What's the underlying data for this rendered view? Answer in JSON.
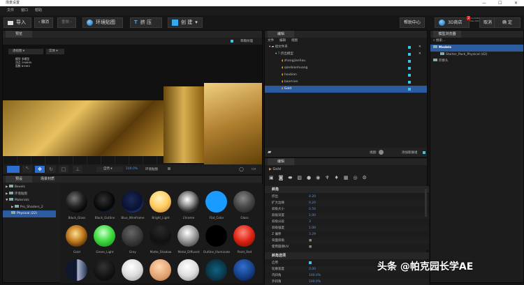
{
  "window": {
    "title": "场景设置",
    "minimize": "—",
    "maximize": "☐",
    "close": "✕"
  },
  "menu": [
    "文件",
    "窗口",
    "帮助"
  ],
  "toolbar": {
    "import": "导入",
    "undo": "‹ 撤消",
    "redo": "重做 ›",
    "env_map": "环境贴图",
    "extrude": "挤 压",
    "create": "创 建",
    "help": "帮助中心",
    "store": "3D商店",
    "store_badge": "2",
    "cancel": "取消",
    "ok": "确 定",
    "gpu_info": "Quadro M2000/PCIe/SSE2",
    "gpu_info2": "1024/4096 MB Video RAM",
    "product": "Element",
    "version": "2.2.2"
  },
  "viewport": {
    "tab": "预览",
    "draft_texture": "草稿纹理",
    "camera_select": "透视图",
    "render_mode": "实体",
    "stats": [
      {
        "k": "模型",
        "v": "多模型"
      },
      {
        "k": "顶点",
        "v": "290895"
      },
      {
        "k": "面数",
        "v": "83365"
      }
    ],
    "shading": "自然",
    "zoom": "100.0%",
    "env_label": "环境贴图"
  },
  "library": {
    "tabs": [
      "预设",
      "场景材质"
    ],
    "tree": [
      {
        "label": "Bevels",
        "level": 0,
        "arrow": "▶"
      },
      {
        "label": "环境贴图",
        "level": 0,
        "arrow": "▶"
      },
      {
        "label": "Materials",
        "level": 0,
        "arrow": "▼"
      },
      {
        "label": "Pro_Shaders_2",
        "level": 1,
        "arrow": "▶"
      },
      {
        "label": "Physical (22)",
        "level": 1,
        "arrow": "",
        "selected": true
      }
    ],
    "materials": [
      {
        "name": "Black_Gloss",
        "bg": "radial-gradient(circle at 40% 35%,#777,#222 45%,#000 80%)"
      },
      {
        "name": "Black_Outline",
        "bg": "radial-gradient(circle at 45% 40%,#333,#050505 60%,#2a4b88 95%)"
      },
      {
        "name": "Blue_Wireframe",
        "bg": "radial-gradient(circle at 45% 40%,#1c2a55,#0a1030 60%,#3a6cf0 95%)"
      },
      {
        "name": "Bright_Light",
        "bg": "radial-gradient(circle at 45% 35%,#fff3c0,#ffcc60 50%,#c08030 95%)"
      },
      {
        "name": "Chrome",
        "bg": "radial-gradient(circle at 45% 40%,#fff,#999 35%,#222 70%,#aaa 95%)"
      },
      {
        "name": "Flat_Color",
        "bg": "#1a9bff"
      },
      {
        "name": "Glass",
        "bg": "radial-gradient(circle at 45% 35%,#888,#444 50%,#222 90%)"
      },
      {
        "name": "Gold",
        "bg": "radial-gradient(circle at 45% 40%,#ffe090,#c07a20 45%,#3a2000 85%)"
      },
      {
        "name": "Green_Light",
        "bg": "radial-gradient(circle at 45% 35%,#d0ffd0,#44dd44 45%,#118811 95%)"
      },
      {
        "name": "Grey",
        "bg": "radial-gradient(circle at 45% 35%,#666,#333 60%,#1a1a1a 95%)"
      },
      {
        "name": "Matte_Shadow",
        "bg": "radial-gradient(circle at 50% 20%,#2a2a2a,#111 60%,#1c1c1c)"
      },
      {
        "name": "Metal_Diffused",
        "bg": "radial-gradient(circle at 45% 35%,#fff,#aaa 40%,#333 90%)"
      },
      {
        "name": "Outline_Illuminate",
        "bg": "radial-gradient(circle,#000 85%,#8a4a20 97%)"
      },
      {
        "name": "Paint_Red",
        "bg": "radial-gradient(circle at 45% 35%,#ff8a7a,#dd2211 50%,#661100 95%)"
      },
      {
        "name": "",
        "bg": "linear-gradient(90deg,#101830 50%,#aab4cc 55%,#223050)"
      },
      {
        "name": "",
        "bg": "radial-gradient(circle at 45% 35%,#333,#111 60%,#080808)"
      },
      {
        "name": "",
        "bg": "radial-gradient(circle at 45% 35%,#fff,#ddd 50%,#999 95%)"
      },
      {
        "name": "",
        "bg": "radial-gradient(circle at 45% 35%,#ffd7b0,#e0a070 60%,#a06030)"
      },
      {
        "name": "",
        "bg": "radial-gradient(circle at 45% 35%,#fff,#ddd 50%,#888 95%)"
      },
      {
        "name": "",
        "bg": "radial-gradient(circle,#106080,#0a3040 70%,#4fd0ff 95%)"
      },
      {
        "name": "",
        "bg": "radial-gradient(circle at 45% 35%,#3070d0,#103070 70%,#051530)"
      }
    ]
  },
  "scene": {
    "tab": "编辑",
    "menu": [
      "文件",
      "编辑",
      "视图"
    ],
    "items": [
      {
        "label": "组文件夹",
        "level": 0,
        "icon": "folder"
      },
      {
        "label": "挤出模型",
        "level": 1,
        "icon": "extrude"
      },
      {
        "label": "zhangjianhau",
        "level": 2,
        "icon": "material"
      },
      {
        "label": "qianbianhuang",
        "level": 2,
        "icon": "material"
      },
      {
        "label": "houbian",
        "level": 2,
        "icon": "material"
      },
      {
        "label": "baomian",
        "level": 2,
        "icon": "material"
      },
      {
        "label": "Gold",
        "level": 2,
        "icon": "material",
        "selected": true
      }
    ],
    "view_label": "视图:",
    "add_group": "添加新群组"
  },
  "editor": {
    "tab": "编辑",
    "material": "Gold",
    "section1": "斜角",
    "props1": [
      {
        "k": "挤出",
        "v": "0.20"
      },
      {
        "k": "扩大边缘",
        "v": "0.20"
      },
      {
        "k": "斜角大小",
        "v": "0.50"
      },
      {
        "k": "斜角深度",
        "v": "1.00"
      },
      {
        "k": "斜角分段",
        "v": "3"
      },
      {
        "k": "斜角强度",
        "v": "1.00"
      },
      {
        "k": "Z 偏移",
        "v": "3.29"
      },
      {
        "k": "背面斜角",
        "v": "■"
      },
      {
        "k": "使用圆滑UV",
        "v": "■"
      }
    ],
    "section2": "斜角选项",
    "props2": [
      {
        "k": "启用",
        "v": ""
      },
      {
        "k": "轮廓宽度",
        "v": "0.00"
      },
      {
        "k": "内斜角",
        "v": "100.0%"
      },
      {
        "k": "外斜角",
        "v": "100.0%"
      }
    ]
  },
  "browser": {
    "tab": "模型浏览器",
    "search": "搜索...",
    "items": [
      {
        "label": "Models",
        "level": 0,
        "selected": true
      },
      {
        "label": "Starter_Pack_Physical (42)",
        "level": 1
      },
      {
        "label": "印章头",
        "level": 0
      }
    ]
  },
  "watermark": "头条 @帕克园长学AE"
}
